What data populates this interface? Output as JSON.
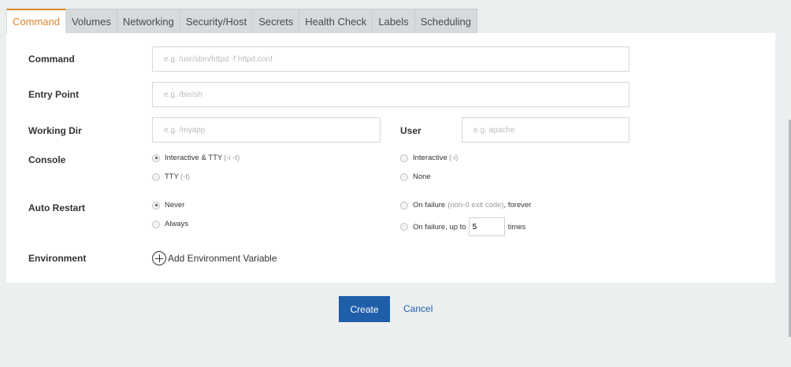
{
  "tabs": [
    {
      "label": "Command",
      "active": true
    },
    {
      "label": "Volumes"
    },
    {
      "label": "Networking"
    },
    {
      "label": "Security/Host"
    },
    {
      "label": "Secrets"
    },
    {
      "label": "Health Check"
    },
    {
      "label": "Labels"
    },
    {
      "label": "Scheduling"
    }
  ],
  "form": {
    "command": {
      "label": "Command",
      "value": "",
      "placeholder": "e.g. /usr/sbin/httpd -f httpd.conf"
    },
    "entry_point": {
      "label": "Entry Point",
      "value": "",
      "placeholder": "e.g. /bin/sh"
    },
    "working_dir": {
      "label": "Working Dir",
      "value": "",
      "placeholder": "e.g. /myapp"
    },
    "user": {
      "label": "User",
      "value": "",
      "placeholder": "e.g. apache"
    },
    "console": {
      "label": "Console",
      "options": {
        "interactive_tty": {
          "label": "Interactive & TTY",
          "hint": "(-i -t)",
          "checked": true
        },
        "interactive": {
          "label": "Interactive",
          "hint": "(-i)",
          "checked": false
        },
        "tty": {
          "label": "TTY",
          "hint": "(-t)",
          "checked": false
        },
        "none": {
          "label": "None",
          "hint": "",
          "checked": false
        }
      }
    },
    "auto_restart": {
      "label": "Auto Restart",
      "options": {
        "never": {
          "label": "Never",
          "checked": true
        },
        "always": {
          "label": "Always",
          "checked": false
        },
        "on_failure_forever": {
          "label_a": "On failure",
          "hint": "(non-0 exit code)",
          "label_b": ", forever",
          "checked": false
        },
        "on_failure_upto": {
          "label_a": "On failure, up to",
          "count": "5",
          "label_b": "times",
          "checked": false
        }
      }
    },
    "environment": {
      "label": "Environment",
      "add_label": "Add Environment Variable"
    }
  },
  "actions": {
    "create": "Create",
    "cancel": "Cancel"
  }
}
